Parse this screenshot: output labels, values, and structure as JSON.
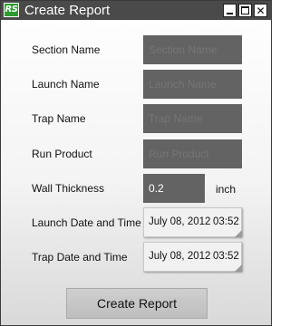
{
  "window": {
    "title": "Create Report",
    "logo_text": "RS",
    "close_glyph": "✕"
  },
  "form": {
    "section_name": {
      "label": "Section Name",
      "placeholder": "Section Name"
    },
    "launch_name": {
      "label": "Launch Name",
      "placeholder": "Launch Name"
    },
    "trap_name": {
      "label": "Trap Name",
      "placeholder": "Trap Name"
    },
    "run_product": {
      "label": "Run Product",
      "placeholder": "Run Product"
    },
    "wall_thickness": {
      "label": "Wall Thickness",
      "value": "0.2",
      "unit": "inch"
    },
    "launch_datetime": {
      "label": "Launch Date and Time",
      "date": "July 08, 2012",
      "time": "03:52"
    },
    "trap_datetime": {
      "label": "Trap Date and Time",
      "date": "July 08, 2012",
      "time": "03:52"
    }
  },
  "actions": {
    "create_report_label": "Create Report"
  },
  "colors": {
    "titlebar": "#4a4a4a",
    "logo_green": "#2f9a2f",
    "field_bg": "#636363",
    "button_bg": "#c6c6c6"
  }
}
